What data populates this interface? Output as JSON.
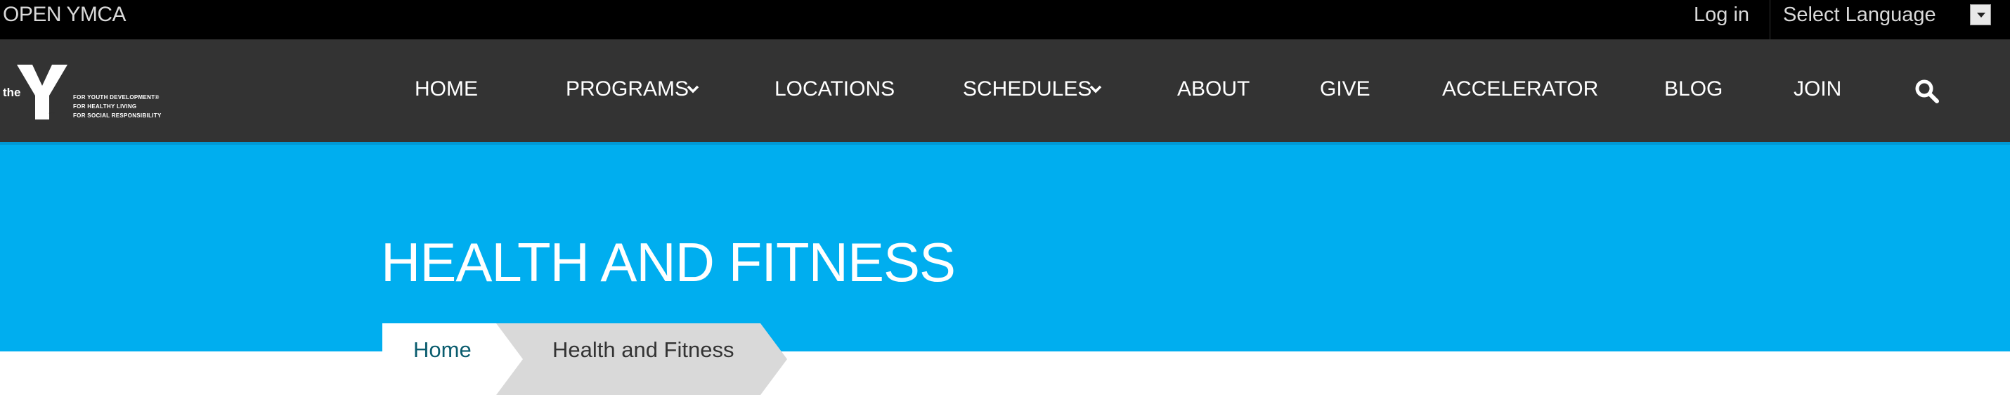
{
  "topbar": {
    "brand": "OPEN YMCA",
    "login": "Log in",
    "language": "Select Language"
  },
  "logo": {
    "the": "the",
    "y": "Y",
    "tagline": [
      "FOR YOUTH DEVELOPMENT®",
      "FOR HEALTHY LIVING",
      "FOR SOCIAL RESPONSIBILITY"
    ]
  },
  "nav": {
    "home": "HOME",
    "programs": "PROGRAMS",
    "locations": "LOCATIONS",
    "schedules": "SCHEDULES",
    "about": "ABOUT",
    "give": "GIVE",
    "accelerator": "ACCELERATOR",
    "blog": "BLOG",
    "join": "JOIN"
  },
  "hero": {
    "title": "HEALTH AND FITNESS"
  },
  "breadcrumb": {
    "home": "Home",
    "current": "Health and Fitness"
  },
  "colors": {
    "topbar": "#000000",
    "navbar": "#333333",
    "hero": "#00aeef",
    "breadcrumb_current": "#d9d9d9",
    "link": "#0a5c6e"
  },
  "icons": {
    "search": "search-icon",
    "chevron": "chevron-down-icon",
    "dropdown": "dropdown-arrow-icon"
  }
}
